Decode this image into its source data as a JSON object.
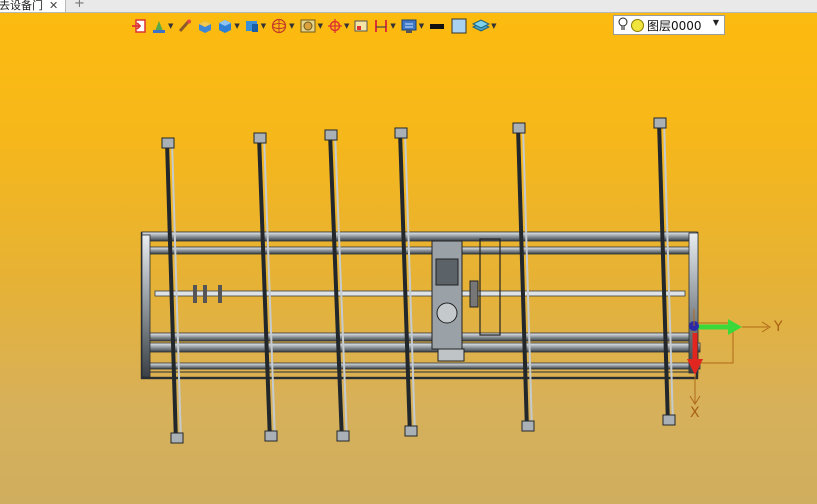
{
  "tab": {
    "title": "去设备门",
    "close_glyph": "✕",
    "add_glyph": "+"
  },
  "toolbar": {
    "items": [
      "exit-icon",
      "paint-icon",
      "brush-icon",
      "solid-box-icon",
      "blue-cube-icon",
      "view-cube-icon",
      "wireframe-sphere-icon",
      "shaded-display-icon",
      "snap-point-icon",
      "frame-icon",
      "section-icon",
      "display-settings-icon",
      "line-color-icon",
      "fill-color-icon",
      "layer-stack-icon"
    ],
    "layer": {
      "name": "图层0000",
      "color": "#f1e43c"
    }
  },
  "triad": {
    "y_label": "Y",
    "x_label": "X"
  },
  "colors": {
    "bg_top": "#fdbb0f",
    "bg_bottom": "#cfae5f",
    "axis_x": "#e0261f",
    "axis_y": "#3bd83b",
    "axis_z": "#2a2aa8"
  }
}
